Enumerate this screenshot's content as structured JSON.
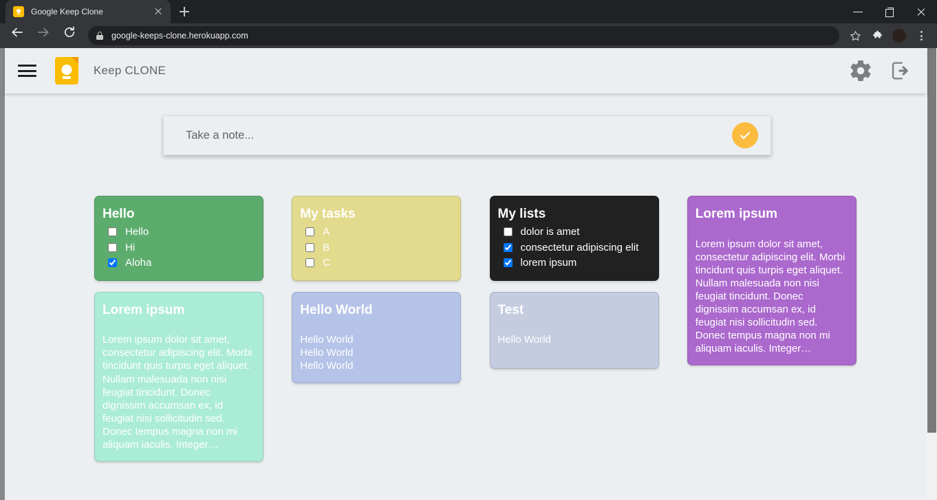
{
  "browser": {
    "tab": {
      "title": "Google Keep Clone",
      "favicon": "keep-favicon",
      "close": "×"
    },
    "new_tab_label": "+",
    "url": "google-keeps-clone.herokuapp.com",
    "lock_icon": "lock-icon",
    "icons": {
      "back": "back-arrow-icon",
      "forward": "forward-arrow-icon",
      "reload": "reload-icon",
      "bookmark": "star-icon",
      "extensions": "puzzle-icon",
      "profile": "avatar-icon",
      "menu": "three-dot-menu-icon"
    },
    "window": {
      "minimize": "minimize-icon",
      "maximize": "restore-icon",
      "close": "close-icon"
    }
  },
  "header": {
    "menu_icon": "hamburger-menu-icon",
    "logo_icon": "google-keep-logo",
    "title": "Keep CLONE",
    "settings_icon": "gear-icon",
    "logout_icon": "logout-icon"
  },
  "note_input": {
    "placeholder": "Take a note...",
    "value": "",
    "submit_icon": "check-circle-icon"
  },
  "notes": [
    {
      "id": "hello",
      "title": "Hello",
      "bg": "#5bа",
      "color": "#5cac6e",
      "type": "checklist",
      "items": [
        {
          "label": "Hello",
          "checked": false
        },
        {
          "label": "Hi",
          "checked": false
        },
        {
          "label": "Aloha",
          "checked": true
        }
      ]
    },
    {
      "id": "lorem-ipsum-mint",
      "title": "Lorem ipsum",
      "color": "#abecd6",
      "type": "text",
      "body": "Lorem ipsum dolor sit amet, consectetur adipiscing elit. Morbi tincidunt quis turpis eget aliquet. Nullam malesuada non nisi feugiat tincidunt. Donec dignissim accumsan ex, id feugiat nisi sollicitudin sed. Donec tempus magna non mi aliquam iaculis. Integer…"
    },
    {
      "id": "my-tasks",
      "title": "My tasks",
      "color": "#e2da8d",
      "type": "checklist",
      "items": [
        {
          "label": "A",
          "checked": false
        },
        {
          "label": "B",
          "checked": false
        },
        {
          "label": "C",
          "checked": false
        }
      ]
    },
    {
      "id": "hello-world",
      "title": "Hello World",
      "color": "#b5c3e8",
      "type": "text",
      "body": "Hello World\nHello World\nHello World"
    },
    {
      "id": "my-lists",
      "title": "My lists",
      "color": "#212121",
      "type": "checklist",
      "items": [
        {
          "label": "dolor is amet",
          "checked": false
        },
        {
          "label": "consectetur adipiscing elit",
          "checked": true
        },
        {
          "label": "lorem ipsum",
          "checked": true
        }
      ]
    },
    {
      "id": "test",
      "title": "Test",
      "color": "#c5cce0",
      "type": "text",
      "body": "Hello World"
    },
    {
      "id": "lorem-ipsum-purple",
      "title": "Lorem ipsum",
      "color": "#ab68cd",
      "type": "text",
      "body": "Lorem ipsum dolor sit amet, consectetur adipiscing elit. Morbi tincidunt quis turpis eget aliquet. Nullam malesuada non nisi feugiat tincidunt. Donec dignissim accumsan ex, id feugiat nisi sollicitudin sed. Donec tempus magna non mi aliquam iaculis. Integer…"
    }
  ],
  "colors": {
    "accent": "#fbbc04",
    "page_bg": "#eceff1",
    "header_bg": "#eceff1",
    "checkbox_checked": "#1a73e8"
  }
}
